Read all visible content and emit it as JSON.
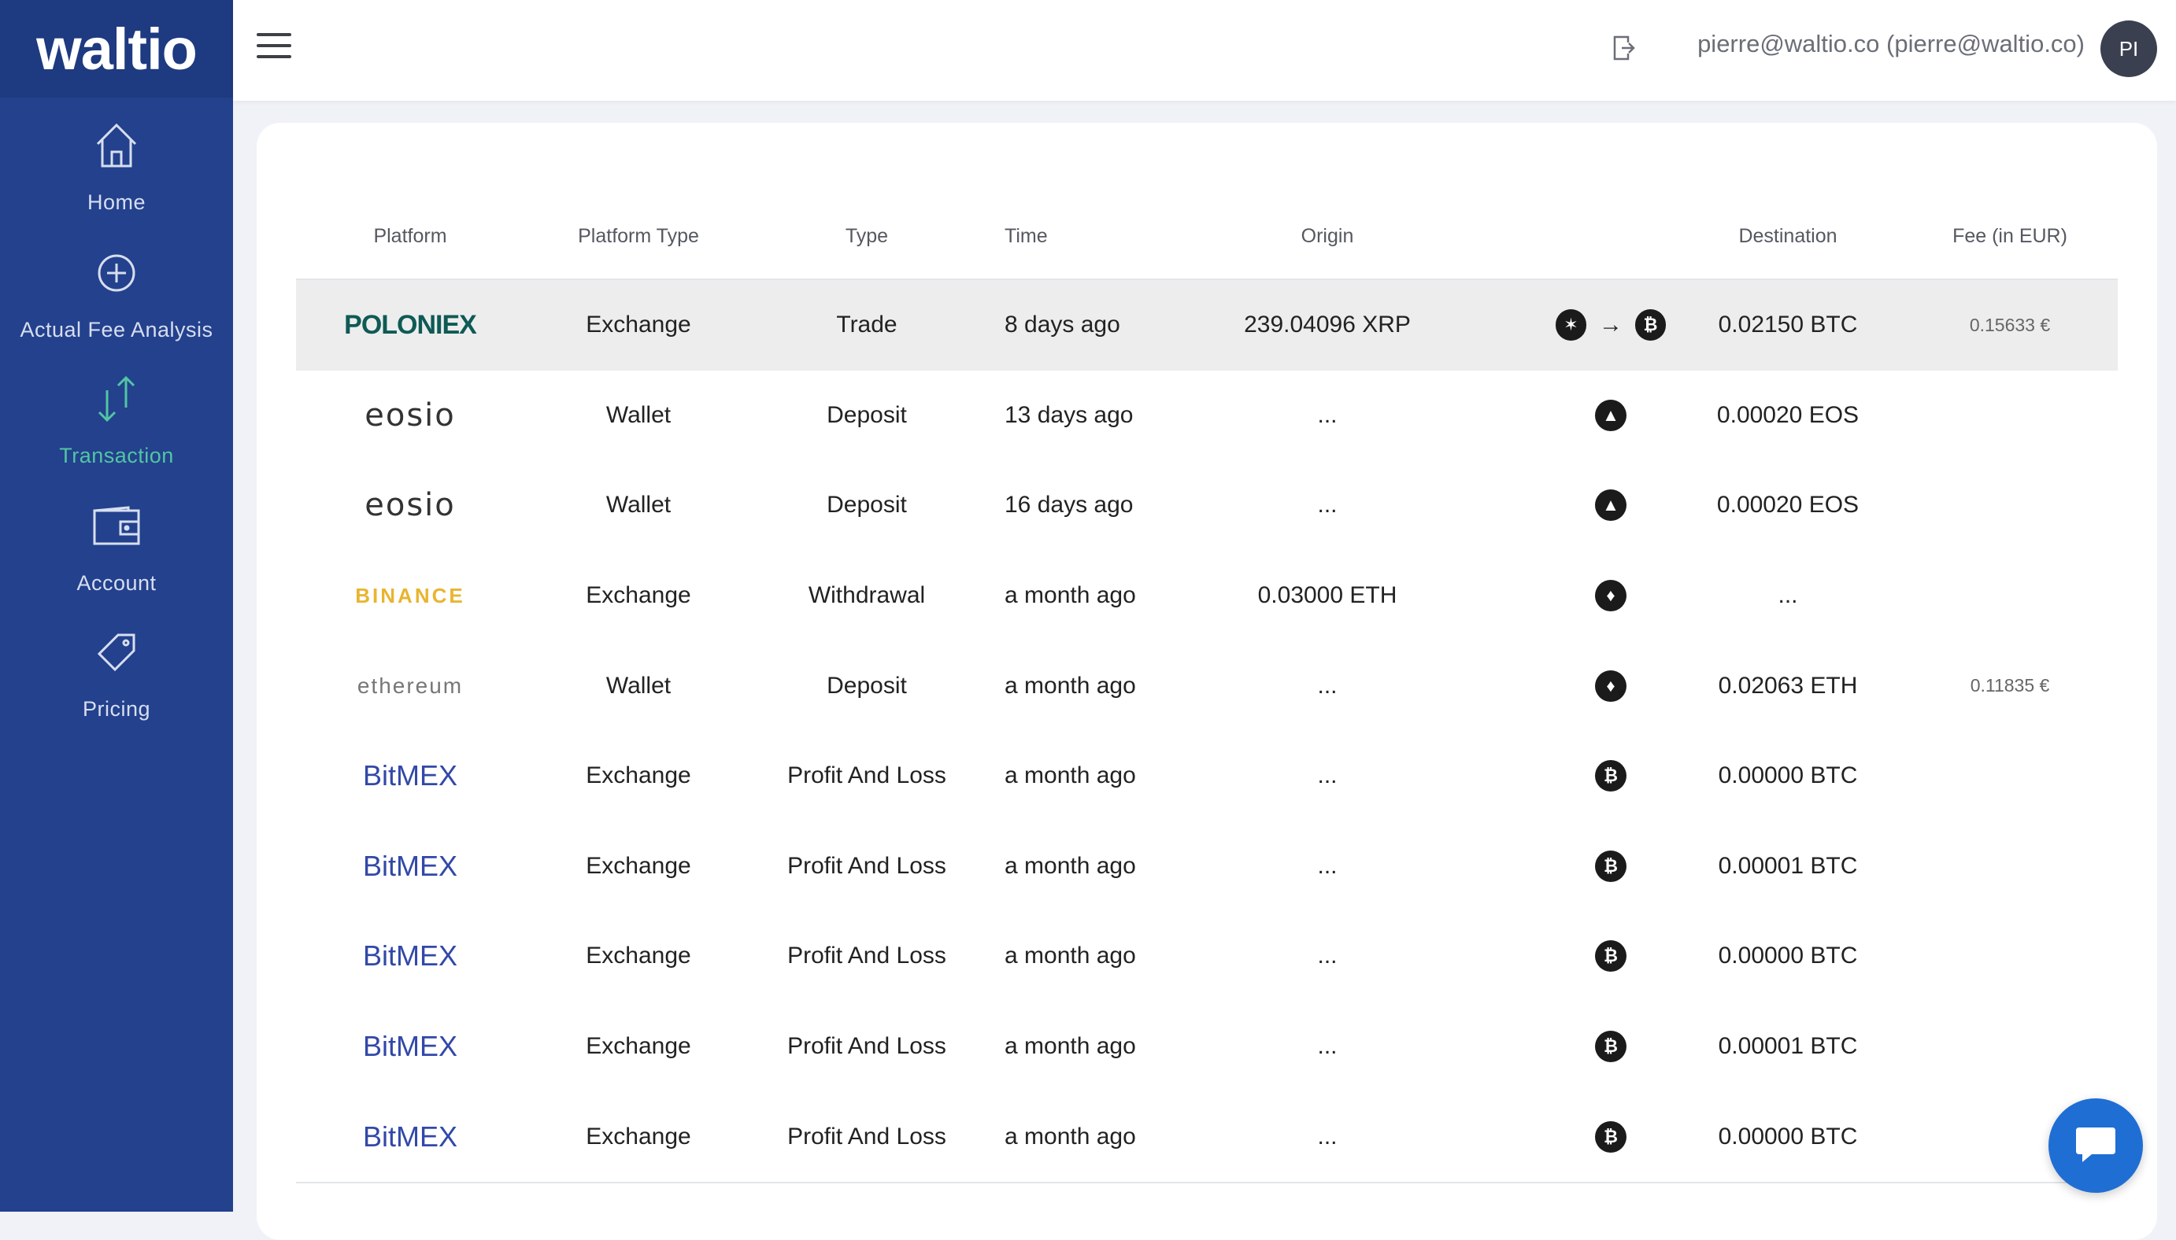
{
  "app": {
    "logo": "waltio"
  },
  "sidebar": {
    "items": [
      {
        "label": "Home",
        "icon": "home-icon",
        "active": false
      },
      {
        "label": "Actual Fee Analysis",
        "icon": "plus-circle-icon",
        "active": false
      },
      {
        "label": "Transaction",
        "icon": "transfer-arrows-icon",
        "active": true
      },
      {
        "label": "Account",
        "icon": "wallet-icon",
        "active": false
      },
      {
        "label": "Pricing",
        "icon": "tag-icon",
        "active": false
      }
    ]
  },
  "header": {
    "user": "pierre@waltio.co (pierre@waltio.co)",
    "avatar_initials": "PI"
  },
  "table": {
    "columns": [
      "Platform",
      "Platform Type",
      "Type",
      "Time",
      "Origin",
      "",
      "Destination",
      "Fee (in EUR)"
    ],
    "rows": [
      {
        "platform": "POLONIEX",
        "platform_type": "Exchange",
        "type": "Trade",
        "time": "8 days ago",
        "origin": "239.04096 XRP",
        "icons": [
          "xrp-coin-icon",
          "arrow-right",
          "btc-coin-icon"
        ],
        "destination": "0.02150 BTC",
        "fee": "0.15633 €"
      },
      {
        "platform": "eosio",
        "platform_type": "Wallet",
        "type": "Deposit",
        "time": "13 days ago",
        "origin": "...",
        "icons": [
          "eos-coin-icon"
        ],
        "destination": "0.00020 EOS",
        "fee": ""
      },
      {
        "platform": "eosio",
        "platform_type": "Wallet",
        "type": "Deposit",
        "time": "16 days ago",
        "origin": "...",
        "icons": [
          "eos-coin-icon"
        ],
        "destination": "0.00020 EOS",
        "fee": ""
      },
      {
        "platform": "BINANCE",
        "platform_type": "Exchange",
        "type": "Withdrawal",
        "time": "a month ago",
        "origin": "0.03000 ETH",
        "icons": [
          "eth-coin-icon"
        ],
        "destination": "...",
        "fee": ""
      },
      {
        "platform": "ethereum",
        "platform_type": "Wallet",
        "type": "Deposit",
        "time": "a month ago",
        "origin": "...",
        "icons": [
          "eth-coin-icon"
        ],
        "destination": "0.02063 ETH",
        "fee": "0.11835 €"
      },
      {
        "platform": "BitMEX",
        "platform_type": "Exchange",
        "type": "Profit And Loss",
        "time": "a month ago",
        "origin": "...",
        "icons": [
          "btc-coin-icon"
        ],
        "destination": "0.00000 BTC",
        "fee": ""
      },
      {
        "platform": "BitMEX",
        "platform_type": "Exchange",
        "type": "Profit And Loss",
        "time": "a month ago",
        "origin": "...",
        "icons": [
          "btc-coin-icon"
        ],
        "destination": "0.00001 BTC",
        "fee": ""
      },
      {
        "platform": "BitMEX",
        "platform_type": "Exchange",
        "type": "Profit And Loss",
        "time": "a month ago",
        "origin": "...",
        "icons": [
          "btc-coin-icon"
        ],
        "destination": "0.00000 BTC",
        "fee": ""
      },
      {
        "platform": "BitMEX",
        "platform_type": "Exchange",
        "type": "Profit And Loss",
        "time": "a month ago",
        "origin": "...",
        "icons": [
          "btc-coin-icon"
        ],
        "destination": "0.00001 BTC",
        "fee": ""
      },
      {
        "platform": "BitMEX",
        "platform_type": "Exchange",
        "type": "Profit And Loss",
        "time": "a month ago",
        "origin": "...",
        "icons": [
          "btc-coin-icon"
        ],
        "destination": "0.00000 BTC",
        "fee": ""
      }
    ]
  },
  "colors": {
    "sidebar": "#23418d",
    "active": "#52c5a3",
    "chat": "#1f6ed4"
  }
}
